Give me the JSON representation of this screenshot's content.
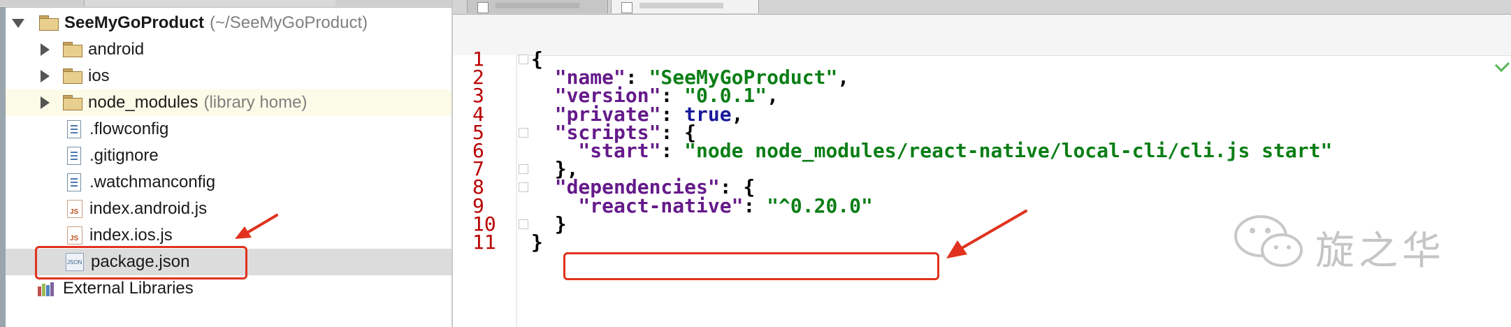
{
  "project": {
    "root_name": "SeeMyGoProduct",
    "root_path": "(~/SeeMyGoProduct)",
    "items": [
      {
        "label": "android",
        "type": "folder"
      },
      {
        "label": "ios",
        "type": "folder"
      },
      {
        "label": "node_modules",
        "note": "(library home)",
        "type": "folder"
      },
      {
        "label": ".flowconfig",
        "type": "file"
      },
      {
        "label": ".gitignore",
        "type": "file"
      },
      {
        "label": ".watchmanconfig",
        "type": "file"
      },
      {
        "label": "index.android.js",
        "type": "js"
      },
      {
        "label": "index.ios.js",
        "type": "js"
      },
      {
        "label": "package.json",
        "type": "json",
        "selected": true
      }
    ],
    "external": "External Libraries"
  },
  "icons": {
    "js_badge": "JS",
    "json_badge": "JSON"
  },
  "editor": {
    "line_numbers": [
      "1",
      "2",
      "3",
      "4",
      "5",
      "6",
      "7",
      "8",
      "9",
      "10",
      "11"
    ],
    "lines": [
      [
        {
          "t": "p",
          "v": "{"
        }
      ],
      [
        {
          "t": "k",
          "v": "  \"name\""
        },
        {
          "t": "p",
          "v": ": "
        },
        {
          "t": "s",
          "v": "\"SeeMyGoProduct\""
        },
        {
          "t": "p",
          "v": ","
        }
      ],
      [
        {
          "t": "k",
          "v": "  \"version\""
        },
        {
          "t": "p",
          "v": ": "
        },
        {
          "t": "s",
          "v": "\"0.0.1\""
        },
        {
          "t": "p",
          "v": ","
        }
      ],
      [
        {
          "t": "k",
          "v": "  \"private\""
        },
        {
          "t": "p",
          "v": ": "
        },
        {
          "t": "kw",
          "v": "true"
        },
        {
          "t": "p",
          "v": ","
        }
      ],
      [
        {
          "t": "k",
          "v": "  \"scripts\""
        },
        {
          "t": "p",
          "v": ": {"
        }
      ],
      [
        {
          "t": "k",
          "v": "    \"start\""
        },
        {
          "t": "p",
          "v": ": "
        },
        {
          "t": "s",
          "v": "\"node node_modules/react-native/local-cli/cli.js start\""
        }
      ],
      [
        {
          "t": "p",
          "v": "  },"
        }
      ],
      [
        {
          "t": "k",
          "v": "  \"dependencies\""
        },
        {
          "t": "p",
          "v": ": {"
        }
      ],
      [
        {
          "t": "k",
          "v": "    \"react-native\""
        },
        {
          "t": "p",
          "v": ": "
        },
        {
          "t": "s",
          "v": "\"^0.20.0\""
        }
      ],
      [
        {
          "t": "p",
          "v": "  }"
        }
      ],
      [
        {
          "t": "p",
          "v": "}"
        }
      ]
    ]
  },
  "watermark": {
    "text": "旋之华"
  },
  "colors": {
    "annotation": "#e0321e",
    "line_number": "#b80000",
    "json_key": "#651a8a",
    "json_string": "#0b7e16",
    "json_keyword": "#1a1a9c"
  }
}
